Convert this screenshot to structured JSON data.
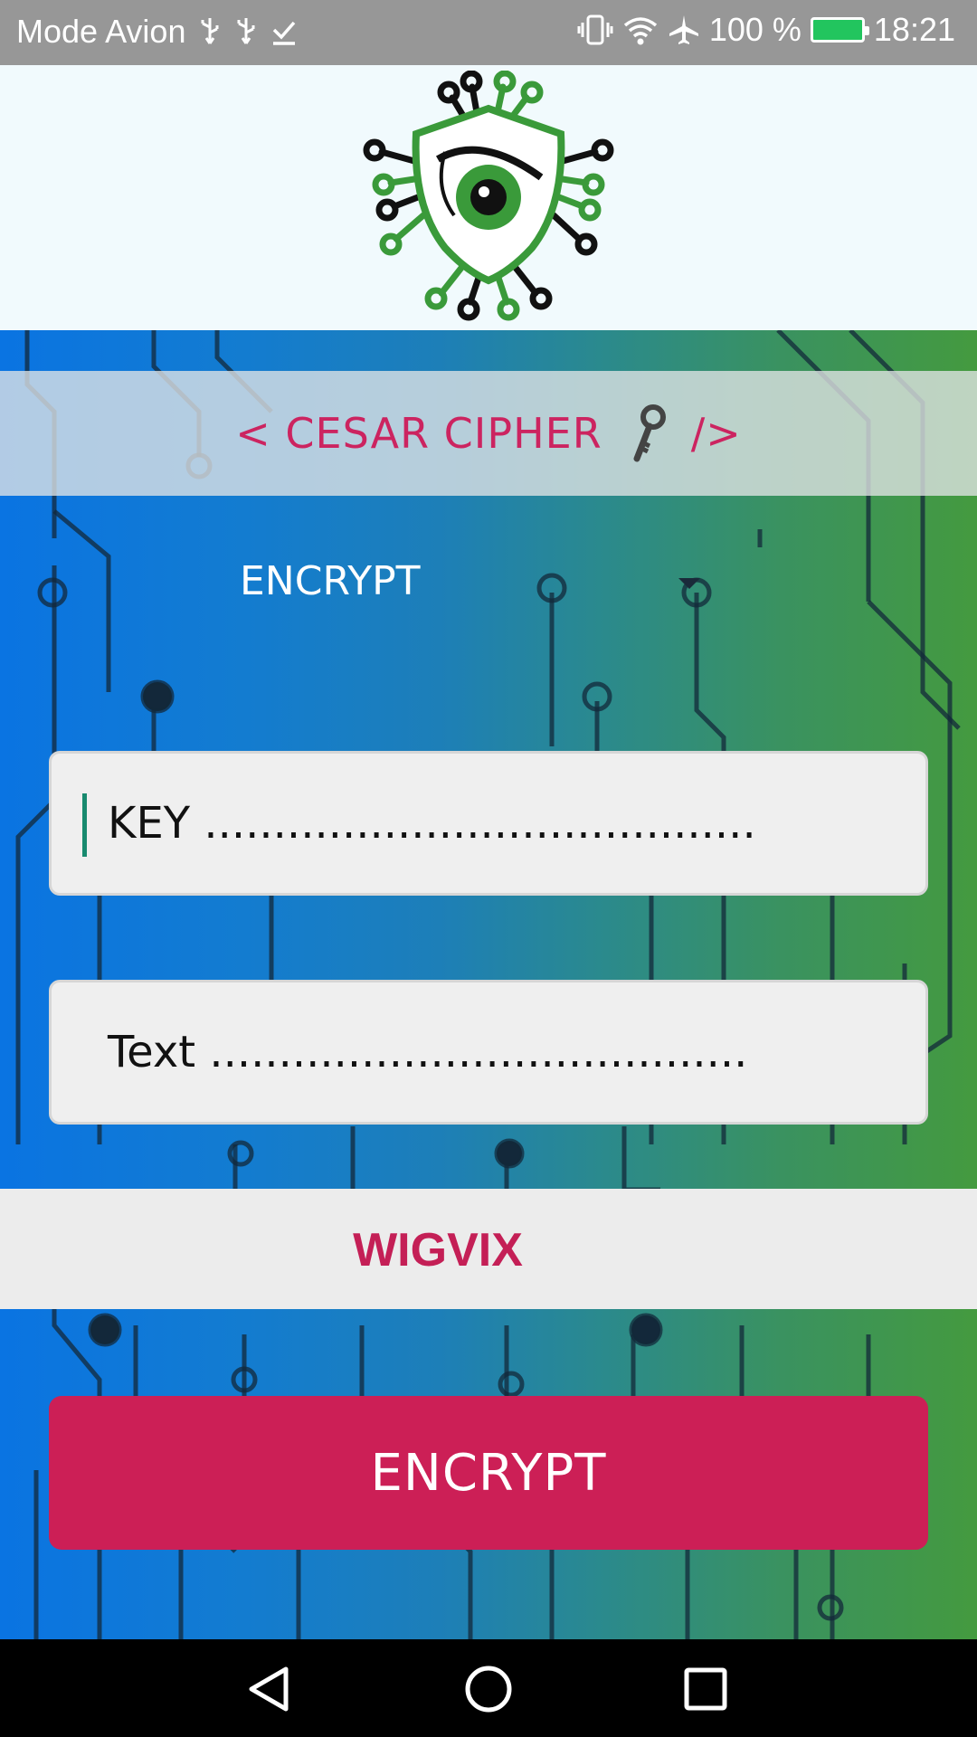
{
  "status_bar": {
    "left_text": "Mode Avion",
    "battery": "100 %",
    "time": "18:21",
    "icons": [
      "usb-icon",
      "usb-icon",
      "download-done-icon",
      "vibrate-icon",
      "wifi-icon",
      "airplane-icon",
      "battery-charging-icon"
    ]
  },
  "header": {
    "logo": "eye-shield-circuit-logo"
  },
  "title": {
    "open_tag": "< CESAR CIPHER",
    "close_tag": "/>",
    "icon": "key-icon"
  },
  "mode_select": {
    "selected": "ENCRYPT"
  },
  "key_field": {
    "value": "KEY ........................................"
  },
  "text_field": {
    "value": "Text ......................................."
  },
  "result": {
    "value": "WIGVIX"
  },
  "action_button": {
    "label": "ENCRYPT"
  },
  "nav_bar": {
    "icons": [
      "back-icon",
      "home-icon",
      "recents-icon"
    ]
  },
  "colors": {
    "accent": "#cc1f56",
    "gradient_start": "#0a74e2",
    "gradient_end": "#449a3f",
    "logo_green": "#3a9a3a",
    "caret": "#188a6f"
  }
}
